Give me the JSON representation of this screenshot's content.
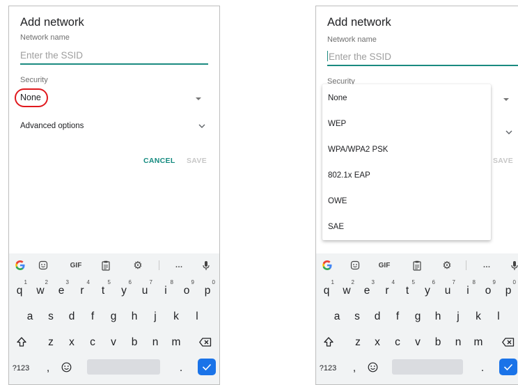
{
  "left": {
    "title": "Add network",
    "network_name_label": "Network name",
    "ssid_placeholder": "Enter the SSID",
    "security_label": "Security",
    "security_value": "None",
    "advanced_label": "Advanced options",
    "cancel_label": "CANCEL",
    "save_label": "SAVE"
  },
  "right": {
    "title": "Add network",
    "network_name_label": "Network name",
    "ssid_placeholder": "Enter the SSID",
    "security_label": "Security",
    "save_label": "SAVE",
    "security_options": [
      "None",
      "WEP",
      "WPA/WPA2 PSK",
      "802.1x EAP",
      "OWE",
      "SAE"
    ]
  },
  "keyboard": {
    "gif_label": "GIF",
    "more_label": "…",
    "row1": [
      "q",
      "w",
      "e",
      "r",
      "t",
      "y",
      "u",
      "i",
      "o",
      "p"
    ],
    "row1_hints": [
      "1",
      "2",
      "3",
      "4",
      "5",
      "6",
      "7",
      "8",
      "9",
      "0"
    ],
    "row2": [
      "a",
      "s",
      "d",
      "f",
      "g",
      "h",
      "j",
      "k",
      "l"
    ],
    "row3": [
      "z",
      "x",
      "c",
      "v",
      "b",
      "n",
      "m"
    ],
    "symbols_label": "?123",
    "comma_label": ",",
    "period_label": ".",
    "google_label": "G",
    "icons": [
      "google-icon",
      "emoji-sticker-icon",
      "gif-icon",
      "clipboard-icon",
      "gear-icon",
      "more-icon",
      "microphone-icon",
      "shift-icon",
      "backspace-icon",
      "emoji-icon",
      "enter-check-icon"
    ]
  },
  "colors": {
    "accent_teal": "#1a8a80",
    "highlight_red": "#e0181d",
    "enter_blue": "#1a73e8"
  }
}
